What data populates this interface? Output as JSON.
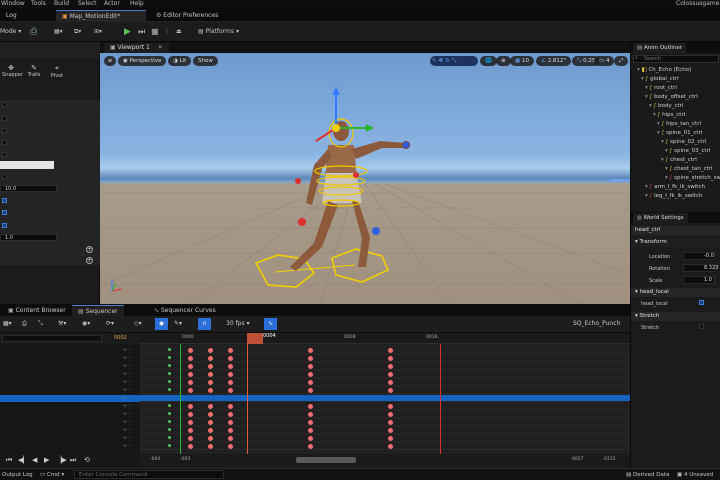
{
  "menubar": {
    "items": [
      "Window",
      "Tools",
      "Build",
      "Select",
      "Actor",
      "Help"
    ],
    "project": "Colossusgame"
  },
  "tabs": {
    "log": "Log",
    "map": "Map_MotionEdit*",
    "editor_prefs": "Editor Preferences"
  },
  "toolbar": {
    "mode": "Mode",
    "platforms": "Platforms"
  },
  "left_panel": {
    "tools": [
      "Snapper",
      "Trails",
      "Pivot"
    ],
    "values": [
      "10.0",
      "1.0"
    ]
  },
  "viewport": {
    "tab": "Viewport 1",
    "perspective": "Perspective",
    "lit": "Lit",
    "show": "Show",
    "grid_snap": "10",
    "angle_snap": "2.812°",
    "scale_snap": "0.25",
    "cam_speed": "4"
  },
  "outliner": {
    "title": "Anim Outliner",
    "search_placeholder": "Search",
    "items": [
      {
        "label": "Ch_Echo (Echo)",
        "kind": "root"
      },
      {
        "label": "global_ctrl",
        "kind": "bone"
      },
      {
        "label": "root_ctrl",
        "kind": "bone"
      },
      {
        "label": "body_offset_ctrl",
        "kind": "bone"
      },
      {
        "label": "body_ctrl",
        "kind": "bone"
      },
      {
        "label": "hips_ctrl",
        "kind": "bone"
      },
      {
        "label": "hips_tan_ctrl",
        "kind": "bone"
      },
      {
        "label": "spine_01_ctrl",
        "kind": "bone"
      },
      {
        "label": "spine_02_ctrl",
        "kind": "bone"
      },
      {
        "label": "spine_03_ctrl",
        "kind": "bone"
      },
      {
        "label": "chest_ctrl",
        "kind": "bone"
      },
      {
        "label": "chest_tan_ctrl",
        "kind": "bone"
      },
      {
        "label": "spine_stretch_switch",
        "kind": "switch"
      },
      {
        "label": "arm_l_fk_ik_switch",
        "kind": "switch"
      },
      {
        "label": "leg_l_fk_ik_switch",
        "kind": "switch"
      }
    ]
  },
  "world_settings": {
    "title": "World Settings",
    "section_head": "head_ctrl",
    "transform": "Transform",
    "location_label": "Location",
    "location_value": "-0.0",
    "rotation_label": "Rotation",
    "rotation_value": "8.323",
    "scale_label": "Scale",
    "scale_value": "1.0",
    "head_local_section": "head_local",
    "head_local_label": "head_local",
    "stretch_section": "Stretch",
    "stretch_label": "Stretch"
  },
  "sequencer": {
    "tabs": [
      "Content Browser",
      "Sequencer",
      "Sequencer Curves"
    ],
    "fps": "30 fps",
    "sequence_name": "SQ_Echo_Punch",
    "frame_current": "0004",
    "frame_field": "0002",
    "ticks": [
      "0000",
      "0008",
      "0016"
    ],
    "range_start": "-004",
    "range_in": "-003",
    "range_out": "0027",
    "range_end": "0155",
    "track_ctrl_glyph": "+◦◦",
    "selected_row": 6,
    "row_count": 13,
    "key_frames": [
      -2,
      0,
      2,
      4,
      12,
      20
    ],
    "frame_range": [
      -4,
      27
    ]
  },
  "statusbar": {
    "output_log": "Output Log",
    "cmd": "Cmd",
    "cmd_placeholder": "Enter Console Command",
    "derived_data": "Derived Data",
    "unsaved": "4 Unsaved"
  }
}
